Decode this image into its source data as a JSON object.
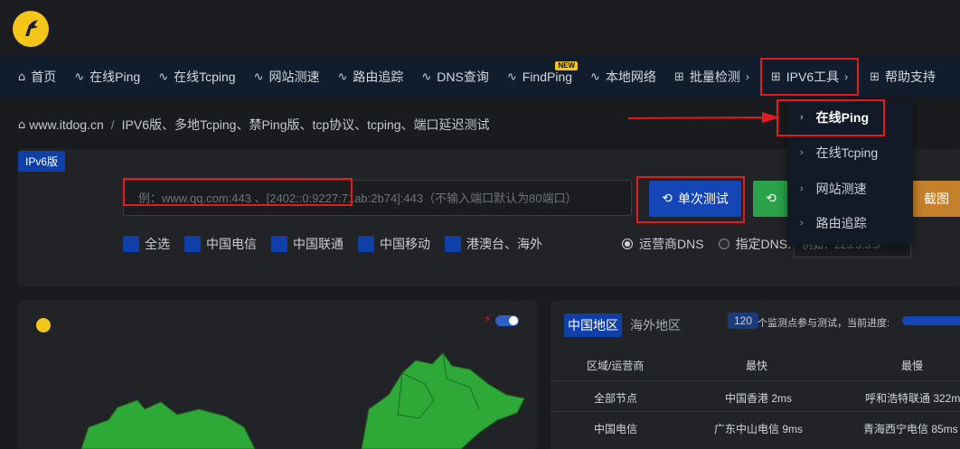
{
  "nav": {
    "items": [
      {
        "icon": "home-icon",
        "label": "首页"
      },
      {
        "icon": "pulse-icon",
        "label": "在线Ping"
      },
      {
        "icon": "pulse-icon",
        "label": "在线Tcping"
      },
      {
        "icon": "pulse-icon",
        "label": "网站测速"
      },
      {
        "icon": "pulse-icon",
        "label": "路由追踪"
      },
      {
        "icon": "pulse-icon",
        "label": "DNS查询"
      },
      {
        "icon": "pulse-icon",
        "label": "FindPing",
        "badge": "NEW"
      },
      {
        "icon": "pulse-icon",
        "label": "本地网络"
      },
      {
        "icon": "grid-icon",
        "label": "批量检测",
        "arrow": "›"
      },
      {
        "icon": "grid-icon",
        "label": "IPV6工具",
        "arrow": "›"
      },
      {
        "icon": "grid-icon",
        "label": "帮助支持"
      }
    ]
  },
  "dropdown": {
    "items": [
      {
        "label": "在线Ping"
      },
      {
        "label": "在线Tcping"
      },
      {
        "label": "网站测速"
      },
      {
        "label": "路由追踪"
      }
    ]
  },
  "breadcrumb": {
    "site": "www.itdog.cn",
    "sep": "/",
    "page": "IPV6版、多地Tcping、禁Ping版、tcp协议、tcping、端口延迟测试"
  },
  "search": {
    "tag": "IPv6版",
    "placeholder": "例：www.qq.com:443 、[2402::0:9227:71ab:2b74]:443（不输入端口默认为80端口）",
    "single_label": "单次测试",
    "screenshot_label": "截图"
  },
  "filters": {
    "checkboxes": [
      "全选",
      "中国电信",
      "中国联通",
      "中国移动",
      "港澳台、海外"
    ],
    "dns_isp": "运营商DNS",
    "dns_custom": "指定DNS:",
    "dns_placeholder": "例如：223.5.5.5"
  },
  "results": {
    "tab_cn": "中国地区",
    "tab_overseas": "海外地区",
    "count": "120",
    "count_text": "个监测点参与测试，当前进度:",
    "progress": 1.0,
    "headers": [
      "区域/运营商",
      "最快",
      "最慢"
    ],
    "rows": [
      [
        "全部节点",
        "中国香港 2ms",
        "呼和浩特联通 322ms"
      ],
      [
        "中国电信",
        "广东中山电信 9ms",
        "青海西宁电信 85ms"
      ]
    ]
  },
  "colors": {
    "accent": "#1546b8",
    "highlight": "#e8191c",
    "map_fill": "#2ea836",
    "logo": "#f5c518"
  }
}
